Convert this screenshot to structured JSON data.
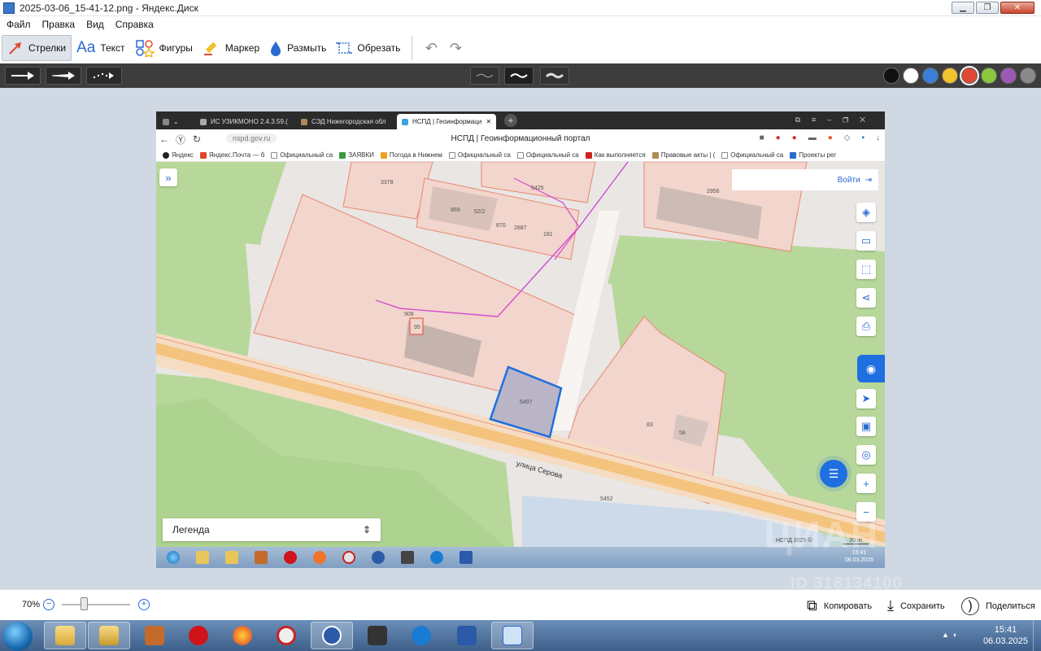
{
  "window": {
    "title": "2025-03-06_15-41-12.png - Яндекс.Диск"
  },
  "menu": [
    "Файл",
    "Правка",
    "Вид",
    "Справка"
  ],
  "toolbar": {
    "tools": [
      {
        "label": "Стрелки",
        "icon": "arrow-icon",
        "active": true
      },
      {
        "label": "Текст",
        "icon": "text-icon"
      },
      {
        "label": "Фигуры",
        "icon": "shapes-icon"
      },
      {
        "label": "Маркер",
        "icon": "marker-icon"
      },
      {
        "label": "Размыть",
        "icon": "blur-icon"
      },
      {
        "label": "Обрезать",
        "icon": "crop-icon"
      }
    ]
  },
  "palette": {
    "colors": [
      "#111111",
      "#ffffff",
      "#3b7dd8",
      "#f2c12e",
      "#e04836",
      "#8cc63f",
      "#9b59b6",
      "#8a8a8a"
    ],
    "selected": "#e04836"
  },
  "screenshot": {
    "tabs": [
      {
        "label": "ИС УЗИКМОНО 2.4.3.59.(",
        "active": false
      },
      {
        "label": "СЭД Нижегородская обл",
        "active": false
      },
      {
        "label": "НСПД | Геоинформаци",
        "active": true
      }
    ],
    "url": "nspd.gov.ru",
    "page_title": "НСПД | Геоинформационный портал",
    "bookmarks": [
      "Яндекс",
      "Яндекс.Почта — б",
      "Официальный са",
      "ЗАЯВКИ",
      "Погода в Нижнем",
      "Официальный са",
      "Официальный са",
      "Как выполняется",
      "Правовые акты | (",
      "Официальный са",
      "Проекты рег"
    ],
    "login_label": "Войти",
    "legend_label": "Легенда",
    "map_labels": {
      "p3378": "3378",
      "p5425": "5425",
      "p2956": "2956",
      "p869": "869",
      "p52_2": "52/2",
      "p870": "870",
      "p2887": "2887",
      "p181": "181",
      "p908": "908",
      "p95": "95",
      "p5497": "5497",
      "p83": "83",
      "p58": "58",
      "p5452": "5452",
      "street": "улица Серова"
    },
    "copyright": "НСПД 2025 ©",
    "scale": "20 m",
    "clock_time": "15:41",
    "clock_date": "06.03.2025"
  },
  "zoom": {
    "level_label": "70%",
    "level_percent": 70
  },
  "actions": {
    "copy": "Копировать",
    "save": "Сохранить",
    "share": "Поделиться"
  },
  "taskbar": {
    "time": "15:41",
    "date": "06.03.2025"
  },
  "watermark": {
    "brand": "ЦИАН",
    "id": "ID 318134100"
  }
}
